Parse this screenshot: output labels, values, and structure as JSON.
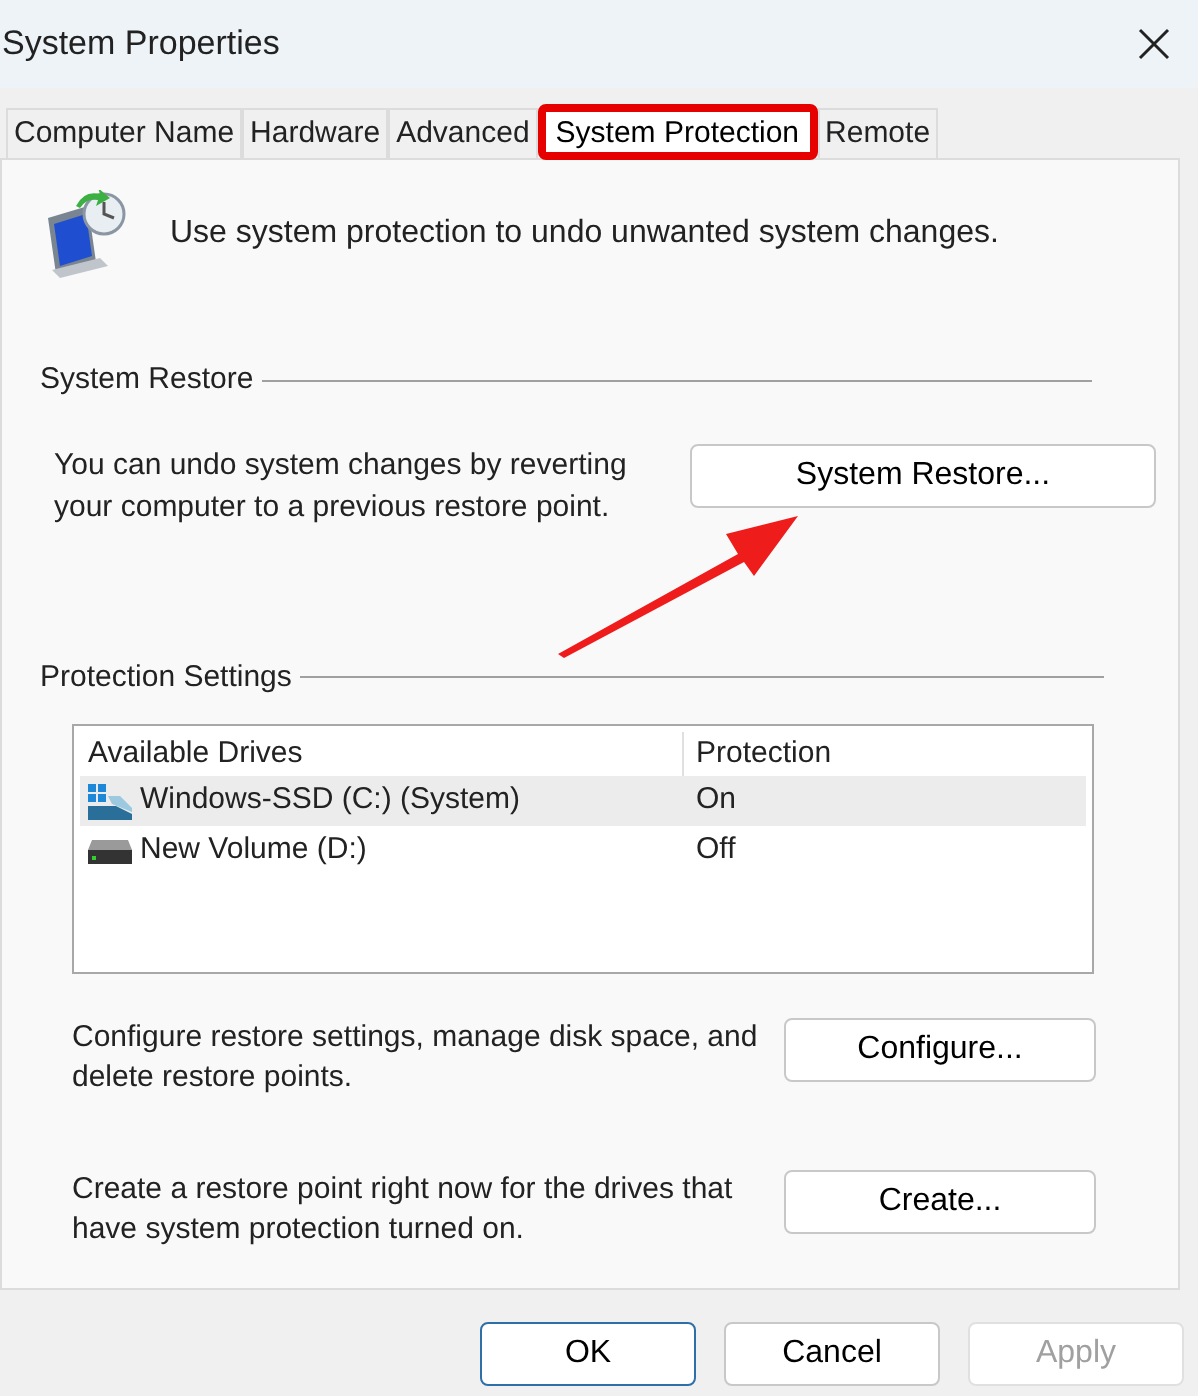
{
  "window": {
    "title": "System Properties"
  },
  "tabs": [
    {
      "label": "Computer Name",
      "selected": false
    },
    {
      "label": "Hardware",
      "selected": false
    },
    {
      "label": "Advanced",
      "selected": false
    },
    {
      "label": "System Protection",
      "selected": true
    },
    {
      "label": "Remote",
      "selected": false
    }
  ],
  "intro": "Use system protection to undo unwanted system changes.",
  "system_restore": {
    "heading": "System Restore",
    "description": "You can undo system changes by reverting your computer to a previous restore point.",
    "button": "System Restore..."
  },
  "protection_settings": {
    "heading": "Protection Settings",
    "table": {
      "columns": [
        "Available Drives",
        "Protection"
      ],
      "rows": [
        {
          "kind": "system",
          "drive": "Windows-SSD (C:) (System)",
          "protection": "On",
          "selected": true
        },
        {
          "kind": "data",
          "drive": "New Volume (D:)",
          "protection": "Off",
          "selected": false
        }
      ]
    },
    "actions": [
      {
        "description": "Configure restore settings, manage disk space, and delete restore points.",
        "button": "Configure..."
      },
      {
        "description": "Create a restore point right now for the drives that have system protection turned on.",
        "button": "Create..."
      }
    ]
  },
  "buttons": [
    {
      "label": "OK",
      "kind": "default",
      "disabled": false
    },
    {
      "label": "Cancel",
      "kind": "normal",
      "disabled": false
    },
    {
      "label": "Apply",
      "kind": "normal",
      "disabled": true
    }
  ]
}
